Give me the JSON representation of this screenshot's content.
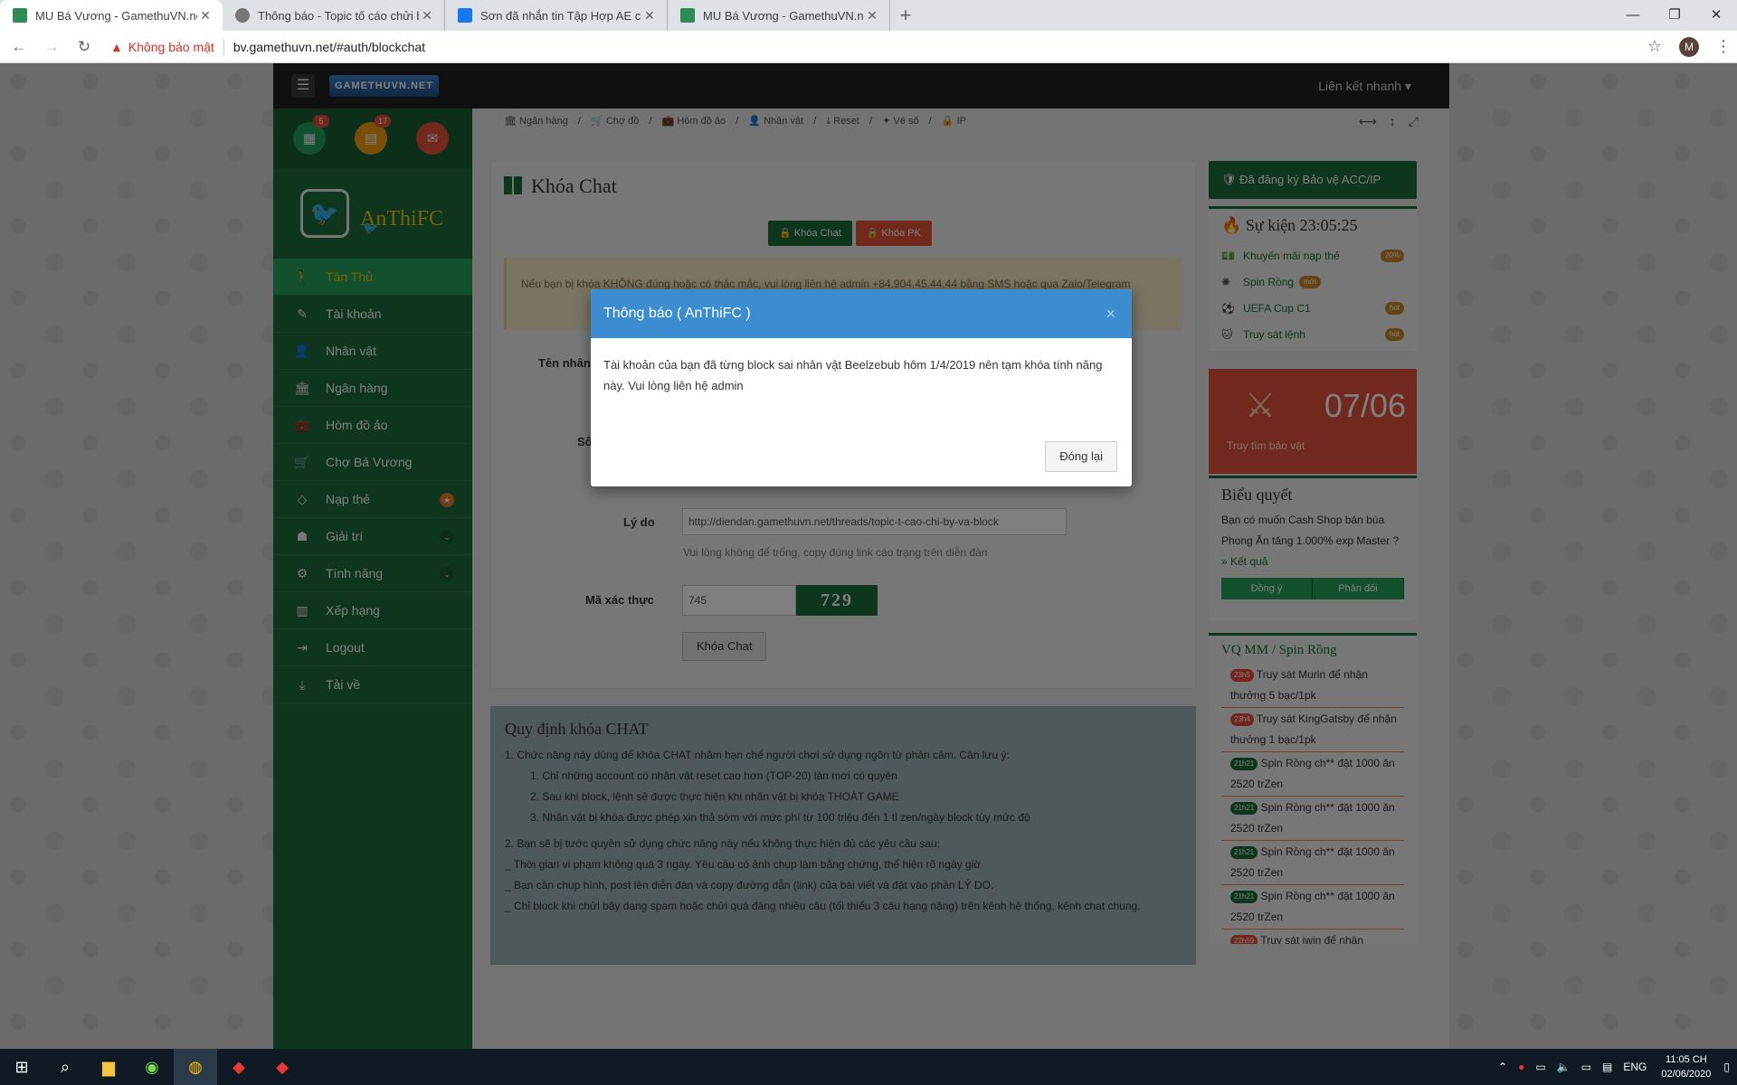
{
  "browser": {
    "tabs": [
      {
        "title": "MU Bá Vương - GamethuVN.net",
        "active": true,
        "fav_color": "#2e8b57"
      },
      {
        "title": "Thông báo - Topic tố cáo chửi bậy",
        "active": false,
        "fav_color": "#777777"
      },
      {
        "title": "Sơn đã nhắn tin Tập Hợp AE chưa",
        "active": false,
        "fav_color": "#1877f2"
      },
      {
        "title": "MU Bá Vương - GamethuVN.net",
        "active": false,
        "fav_color": "#2e8b57"
      }
    ],
    "not_secure": "Không bảo mật",
    "url": "bv.gamethuvn.net/#auth/blockchat",
    "profile_initial": "M"
  },
  "site": {
    "logo": "GAMETHUVN.NET",
    "quick_links": "Liên kết nhanh",
    "badges": [
      "5",
      "17"
    ],
    "username": "AnThiFC",
    "menu": [
      {
        "label": "Tân Thủ",
        "icon": "walker-icon",
        "active": true
      },
      {
        "label": "Tài khoản",
        "icon": "edit-icon"
      },
      {
        "label": "Nhân vật",
        "icon": "user-icon"
      },
      {
        "label": "Ngân hàng",
        "icon": "bank-icon"
      },
      {
        "label": "Hòm đồ ảo",
        "icon": "briefcase-icon"
      },
      {
        "label": "Chợ Bá Vương",
        "icon": "cart-icon"
      },
      {
        "label": "Nạp thẻ",
        "icon": "diamond-icon"
      },
      {
        "label": "Giải trí",
        "icon": "android-icon"
      },
      {
        "label": "Tính năng",
        "icon": "cogs-icon"
      },
      {
        "label": "Xếp hạng",
        "icon": "bar-chart-icon"
      },
      {
        "label": "Logout",
        "icon": "logout-icon"
      },
      {
        "label": "Tải về",
        "icon": "download-icon"
      }
    ],
    "breadcrumb": [
      "Ngân hàng",
      "Chợ đồ",
      "Hòm đồ ảo",
      "Nhân vật",
      "Reset",
      "Vé số",
      "IP"
    ]
  },
  "main": {
    "title": "Khóa Chat",
    "btn_chat": "Khóa Chat",
    "btn_pk": "Khóa PK",
    "warning": "Nếu bạn bị khóa KHÔNG đúng hoặc có thắc mắc, vui lòng liên hệ admin +84.904.45.44.44 bằng SMS hoặc qua Zalo/Telegram",
    "label_name": "Tên nhân",
    "label_so": "Số",
    "label_reason": "Lý do",
    "reason_value": "http://diendan.gamethuvn.net/threads/topic-t-cao-chi-by-va-block",
    "reason_hint": "Vui lòng không để trống, copy đúng link cáo trạng trên diễn đàn",
    "label_captcha": "Mã xác thực",
    "captcha_input": "745",
    "captcha_code": "729",
    "submit": "Khóa Chat"
  },
  "rules": {
    "title": "Quy định khóa CHAT",
    "l1": "1. Chức năng này dùng để khóa CHAT nhằm hạn chế người chơi sử dụng ngôn từ phản cảm. Cần lưu ý:",
    "l1a": "1. Chỉ những account có nhân vật reset cao hơn (TOP-20) lần mới có quyền",
    "l1b": "2. Sau khi block, lệnh sẽ được thực hiện khi nhân vật bị khóa THOÁT GAME",
    "l1c": "3. Nhân vật bị khóa được phép xin thả sớm với mức phí từ 100 triệu đến 1 tỉ zen/ngày block tùy mức độ",
    "l2": "2. Bạn sẽ bị tước quyền sử dụng chức năng này nếu không thực hiện đủ các yêu cầu sau:",
    "l2a": "_ Thời gian vi phạm không quá 3 ngày. Yêu cầu có ảnh chụp làm bằng chứng, thể hiện rõ ngày giờ",
    "l2b": "_ Bạn cần chụp hình, post lên diễn đàn và copy đường dẫn (link) của bài viết và đặt vào phần LÝ DO.",
    "l2c": "_ Chỉ block khi chửi bậy dạng spam hoặc chửi quá đáng nhiều câu (tối thiểu 3 câu hạng nặng) trên kênh hệ thống, kênh chat chung."
  },
  "right": {
    "protect": "Đã đăng ký Bảo vệ ACC/IP",
    "event_title": "Sự kiện 23:05:25",
    "events": [
      {
        "label": "Khuyến mãi nạp thẻ",
        "tag": "20%"
      },
      {
        "label": "Spin Rồng",
        "tag": "mới"
      },
      {
        "label": "UEFA Cup C1",
        "tag": "hot"
      },
      {
        "label": "Truy sát lệnh",
        "tag": "hot"
      }
    ],
    "hunt_date": "07/06",
    "hunt_label": "Truy tìm bảo vật",
    "vote_title": "Biểu quyết",
    "vote_text": "Bạn có muốn Cash Shop bán bùa Phong Ấn tăng 1.000% exp Master ?",
    "vote_result": "» Kết quả",
    "vote_yes": "Đồng ý",
    "vote_no": "Phản đối",
    "spin_title": "VQ MM / Spin Rồng",
    "spin_items": [
      {
        "time": "23h5",
        "text": "Truy sát Murin để nhận thưởng 5 bạc/1pk"
      },
      {
        "time": "23h4",
        "text": "Truy sát KingGatsby để nhận thưởng 1 bạc/1pk"
      },
      {
        "time": "21h21",
        "text": "Spin Rồng ch** đặt 1000 ăn 2520 trZen"
      },
      {
        "time": "21h21",
        "text": "Spin Rồng ch** đặt 1000 ăn 2520 trZen"
      },
      {
        "time": "21h21",
        "text": "Spin Rồng ch** đặt 1000 ăn 2520 trZen"
      },
      {
        "time": "21h21",
        "text": "Spin Rồng ch** đặt 1000 ăn 2520 trZen"
      },
      {
        "time": "22h59",
        "text": "Truy sát iwin để nhận"
      }
    ]
  },
  "modal": {
    "title": "Thông báo ( AnThiFC )",
    "body": "Tài khoản của bạn đã từng block sai nhân vật Beelzebub hôm 1/4/2019 nên tạm khóa tính năng này. Vui lòng liên hệ admin",
    "close_btn": "Đóng lại"
  },
  "taskbar": {
    "lang": "ENG",
    "time": "11:05 CH",
    "date": "02/06/2020"
  }
}
